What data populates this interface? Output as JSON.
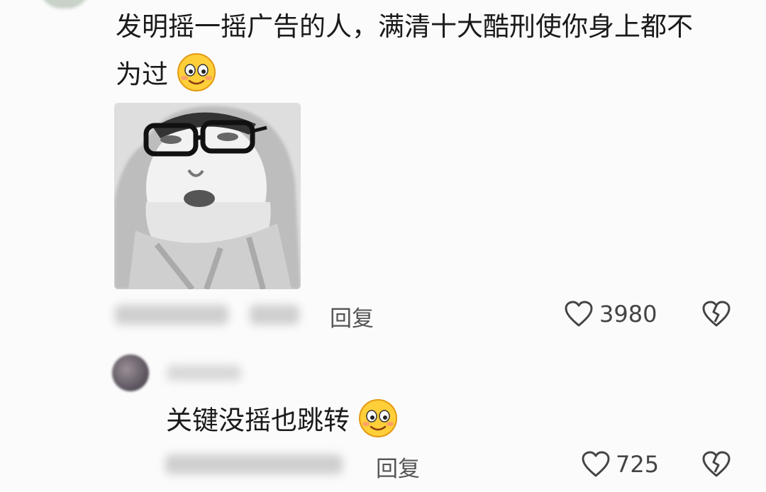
{
  "comment1": {
    "text_line1": "发明摇一摇广告的人，满清十大酷刑使你身上都不",
    "text_line2": "为过",
    "emoji": "smile-emoji",
    "reply_label": "回复",
    "like_count": "3980"
  },
  "comment2": {
    "text": "关键没摇也跳转",
    "emoji": "smile-emoji",
    "reply_label": "回复",
    "like_count": "725"
  },
  "colors": {
    "text": "#1a1a1a",
    "muted": "#555555",
    "background": "#fbfbfb"
  }
}
